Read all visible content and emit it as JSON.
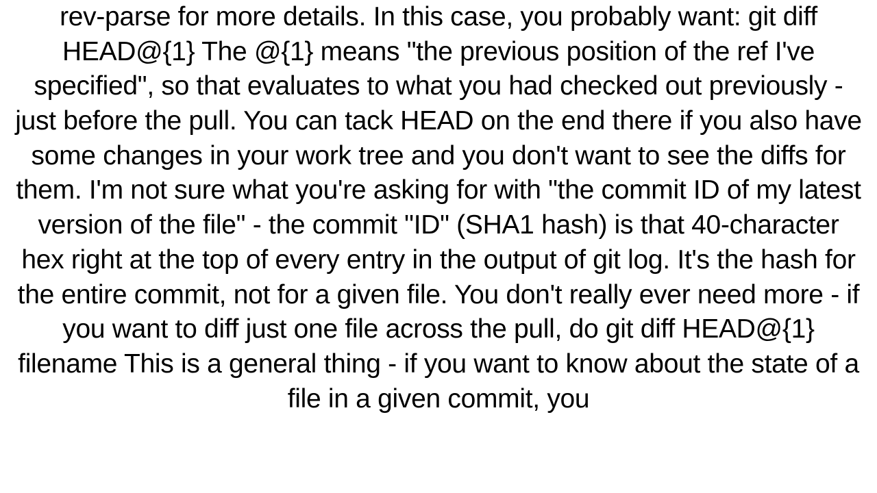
{
  "document": {
    "body_text": "rev-parse for more details. In this case, you probably want: git diff HEAD@{1}  The @{1} means \"the previous position of the ref I've specified\", so that evaluates to what you had checked out previously - just before the pull. You can tack HEAD on the end there if you also have some changes in your work tree and you don't want to see the diffs for them. I'm not sure what you're asking for with \"the commit ID of my latest version of the file\" - the commit \"ID\" (SHA1 hash) is that 40-character hex right at the top of every entry in the output of git log. It's the hash for the entire commit, not for a given file. You don't really ever need more - if you want to diff just one file across the pull, do git diff HEAD@{1} filename  This is a general thing - if you want to know about the state of a file in a given commit, you"
  }
}
